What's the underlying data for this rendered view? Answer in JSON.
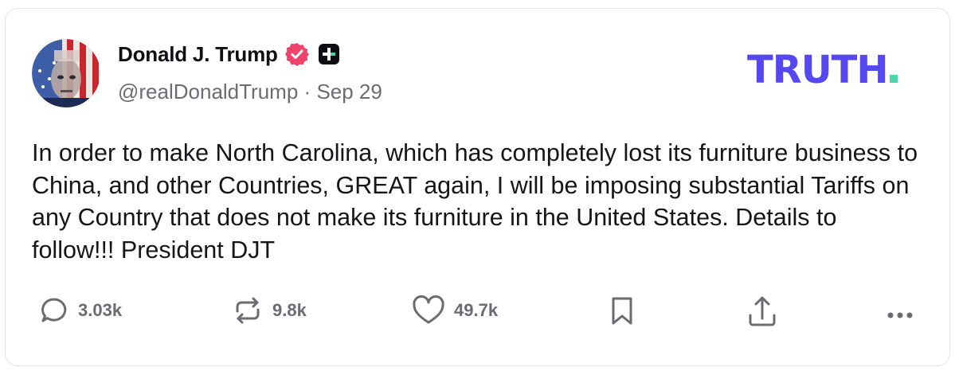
{
  "post": {
    "author": {
      "display_name": "Donald J. Trump",
      "handle": "@realDonaldTrump",
      "separator": "·",
      "date": "Sep 29",
      "verified_icon": "verified-badge-icon",
      "badge_icon": "plus-badge-icon"
    },
    "text": "In order to make North Carolina, which has completely lost its furniture business to China, and other Countries, GREAT again, I will be imposing substantial Tariffs on any Country that does not make its furniture in the United States. Details to follow!!! President DJT",
    "brand": {
      "logo_text": "TRUTH",
      "accent": "#5448ee",
      "dot_color": "#4bd6b0"
    },
    "actions": {
      "replies": {
        "icon": "reply-icon",
        "count": "3.03k"
      },
      "retruths": {
        "icon": "retruth-icon",
        "count": "9.8k"
      },
      "likes": {
        "icon": "heart-icon",
        "count": "49.7k"
      },
      "bookmark": {
        "icon": "bookmark-icon"
      },
      "share": {
        "icon": "share-icon"
      },
      "more": {
        "icon": "more-icon"
      }
    },
    "colors": {
      "verified": "#f0436b",
      "text": "#15151a",
      "muted": "#6b6b73"
    }
  }
}
